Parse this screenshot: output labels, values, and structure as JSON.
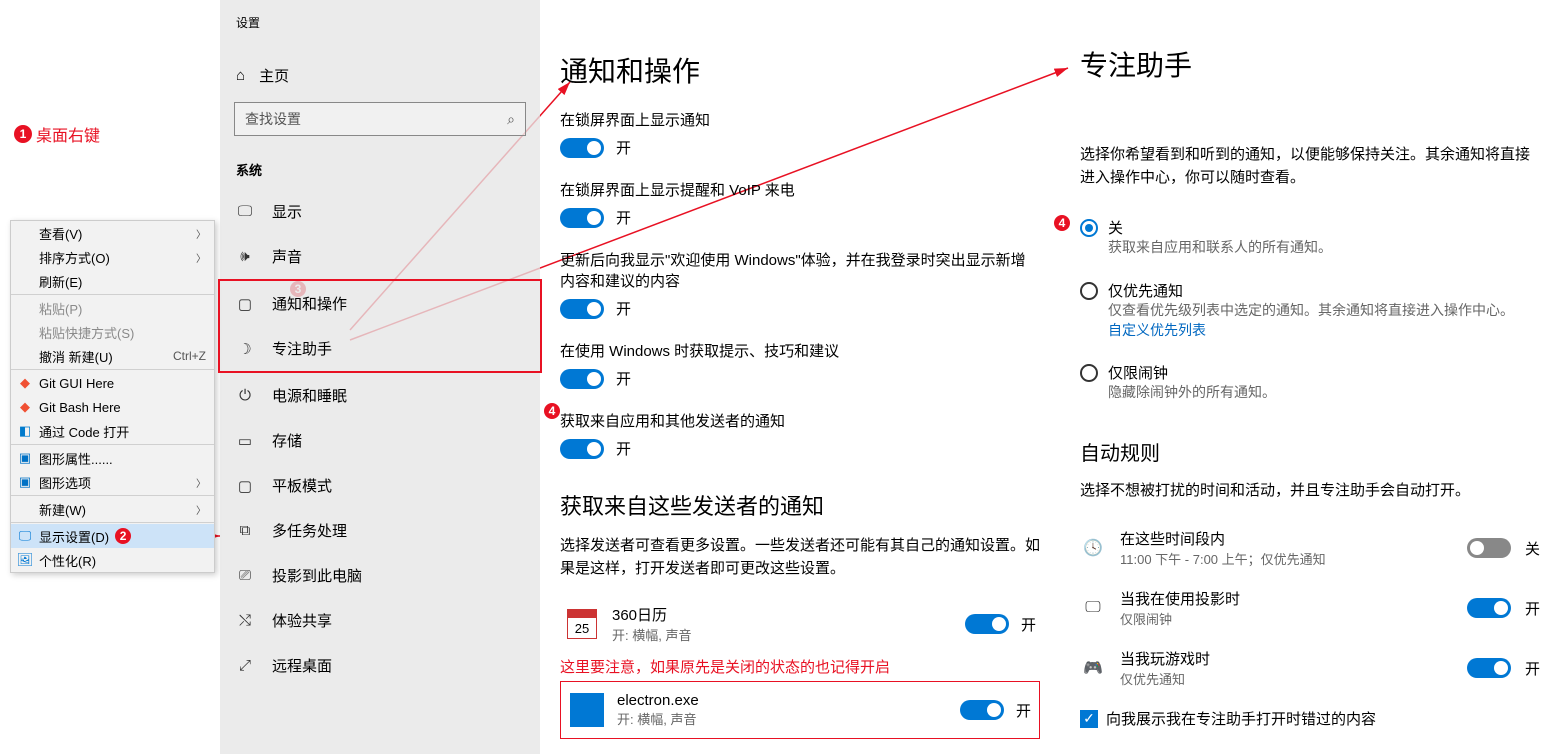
{
  "annotations": {
    "desktop_right_click": "桌面右键",
    "note_senders": "这里要注意，如果原先是关闭的状态的也记得开启"
  },
  "context_menu": {
    "view": "查看(V)",
    "sort": "排序方式(O)",
    "refresh": "刷新(E)",
    "paste": "粘贴(P)",
    "paste_shortcut": "粘贴快捷方式(S)",
    "undo_new": "撤消 新建(U)",
    "undo_hint": "Ctrl+Z",
    "git_gui": "Git GUI Here",
    "git_bash": "Git Bash Here",
    "open_code": "通过 Code 打开",
    "gfx_props": "图形属性......",
    "gfx_opts": "图形选项",
    "new": "新建(W)",
    "display_settings": "显示设置(D)",
    "personalize": "个性化(R)"
  },
  "settings": {
    "title": "设置",
    "home": "主页",
    "search_placeholder": "查找设置",
    "section": "系统",
    "items": {
      "display": "显示",
      "sound": "声音",
      "notifications": "通知和操作",
      "focus": "专注助手",
      "power": "电源和睡眠",
      "storage": "存储",
      "tablet": "平板模式",
      "multitask": "多任务处理",
      "project": "投影到此电脑",
      "shared": "体验共享",
      "remote": "远程桌面"
    }
  },
  "main": {
    "title": "通知和操作",
    "opts": {
      "lock_notif": "在锁屏界面上显示通知",
      "lock_voip": "在锁屏界面上显示提醒和 VoIP 来电",
      "welcome": "更新后向我显示\"欢迎使用 Windows\"体验，并在我登录时突出显示新增内容和建议的内容",
      "tips": "在使用 Windows 时获取提示、技巧和建议",
      "apps": "获取来自应用和其他发送者的通知"
    },
    "on": "开",
    "section2": "获取来自这些发送者的通知",
    "desc2": "选择发送者可查看更多设置。一些发送者还可能有其自己的通知设置。如果是这样，打开发送者即可更改这些设置。",
    "sender1": {
      "name": "360日历",
      "sub": "开: 横幅, 声音"
    },
    "sender2": {
      "name": "electron.exe",
      "sub": "开: 横幅, 声音"
    }
  },
  "focus": {
    "title": "专注助手",
    "desc": "选择你希望看到和听到的通知，以便能够保持关注。其余通知将直接进入操作中心，你可以随时查看。",
    "off": {
      "title": "关",
      "sub": "获取来自应用和联系人的所有通知。"
    },
    "priority": {
      "title": "仅优先通知",
      "sub": "仅查看优先级列表中选定的通知。其余通知将直接进入操作中心。",
      "link": "自定义优先列表"
    },
    "alarms": {
      "title": "仅限闹钟",
      "sub": "隐藏除闹钟外的所有通知。"
    },
    "rules_title": "自动规则",
    "rules_desc": "选择不想被打扰的时间和活动，并且专注助手会自动打开。",
    "rule_time": {
      "title": "在这些时间段内",
      "sub": "11:00 下午 - 7:00 上午；仅优先通知",
      "state": "关"
    },
    "rule_project": {
      "title": "当我在使用投影时",
      "sub": "仅限闹钟",
      "state": "开"
    },
    "rule_game": {
      "title": "当我玩游戏时",
      "sub": "仅优先通知",
      "state": "开"
    },
    "checkbox": "向我展示我在专注助手打开时错过的内容"
  }
}
